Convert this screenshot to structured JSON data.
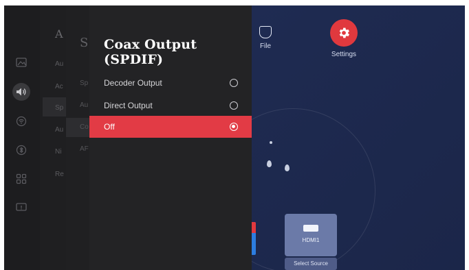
{
  "home": {
    "apps": [
      {
        "label": "File",
        "icon": "file-icon"
      },
      {
        "label": "Settings",
        "icon": "gear-icon",
        "color": "#e0393e"
      }
    ],
    "source_card": {
      "label": "HDMI1",
      "icon": "hdmi-icon",
      "sub_label": "Select Source"
    }
  },
  "sidebar": {
    "icons": [
      "picture-icon",
      "sound-icon",
      "network-icon",
      "bluetooth-icon",
      "apps-icon",
      "system-icon"
    ],
    "active_index": 1
  },
  "menu_level1": {
    "title": "A",
    "items": [
      "Au",
      "Ac",
      "Sp",
      "Au",
      "Ni",
      "Re"
    ],
    "selected_index": 2
  },
  "menu_level2": {
    "title": "S",
    "items": [
      "Sp",
      "Au",
      "Co",
      "AF"
    ],
    "selected_index": 2
  },
  "dialog": {
    "title": "Coax Output (SPDIF)",
    "options": [
      {
        "label": "Decoder Output",
        "selected": false
      },
      {
        "label": "Direct Output",
        "selected": false
      },
      {
        "label": "Off",
        "selected": true
      }
    ],
    "accent_color": "#e23b45"
  }
}
